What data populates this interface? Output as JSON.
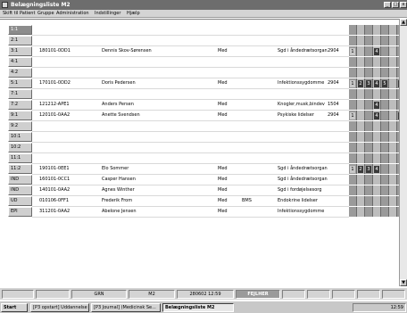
{
  "window": {
    "title": "Belægningsliste M2"
  },
  "menu": [
    "Skift til",
    "Patient",
    "Gruppe",
    "Administration",
    "Indstillinger",
    "Hjælp"
  ],
  "rows": [
    {
      "bed": "1:1",
      "cpr": "",
      "name": "",
      "sex": "",
      "x": "",
      "diag": "",
      "time": "",
      "marks": []
    },
    {
      "bed": "2:1",
      "cpr": "",
      "name": "",
      "sex": "",
      "x": "",
      "diag": "",
      "time": "",
      "marks": []
    },
    {
      "bed": "3:1",
      "cpr": "180101-0DD1",
      "name": "Dennis Skov-Sørensen",
      "sex": "Med",
      "x": "",
      "diag": "Sgd i åndedrætsorgan",
      "time": "2904",
      "marks": [
        {
          "c": 0,
          "t": "1",
          "light": true
        },
        {
          "c": 3,
          "t": "4"
        },
        {
          "c": 5,
          "t": "",
          "light": true
        }
      ]
    },
    {
      "bed": "4:1",
      "cpr": "",
      "name": "",
      "sex": "",
      "x": "",
      "diag": "",
      "time": "",
      "marks": []
    },
    {
      "bed": "4:2",
      "cpr": "",
      "name": "",
      "sex": "",
      "x": "",
      "diag": "",
      "time": "",
      "marks": []
    },
    {
      "bed": "5:1",
      "cpr": "170101-0DD2",
      "name": "Doris Pedersen",
      "sex": "Med",
      "x": "",
      "diag": "Infektionssygdomme",
      "time": "2904",
      "marks": [
        {
          "c": 0,
          "t": "1",
          "light": true
        },
        {
          "c": 1,
          "t": "2"
        },
        {
          "c": 2,
          "t": "3"
        },
        {
          "c": 3,
          "t": "4"
        },
        {
          "c": 4,
          "t": "5"
        },
        {
          "c": 6,
          "t": "7"
        }
      ]
    },
    {
      "bed": "7:1",
      "cpr": "",
      "name": "",
      "sex": "",
      "x": "",
      "diag": "",
      "time": "",
      "marks": []
    },
    {
      "bed": "7:2",
      "cpr": "121212-APE1",
      "name": "Anders Persen",
      "sex": "Med",
      "x": "",
      "diag": "Knogler,musk,bindev",
      "time": "1504",
      "marks": [
        {
          "c": 3,
          "t": "4"
        }
      ]
    },
    {
      "bed": "9:1",
      "cpr": "120101-0AA2",
      "name": "Anette Svendsen",
      "sex": "Med",
      "x": "",
      "diag": "Psykiske lidelser",
      "time": "2904",
      "marks": [
        {
          "c": 0,
          "t": "1",
          "light": true
        },
        {
          "c": 3,
          "t": "4"
        },
        {
          "c": 6,
          "t": "7"
        }
      ]
    },
    {
      "bed": "9:2",
      "cpr": "",
      "name": "",
      "sex": "",
      "x": "",
      "diag": "",
      "time": "",
      "marks": []
    },
    {
      "bed": "10:1",
      "cpr": "",
      "name": "",
      "sex": "",
      "x": "",
      "diag": "",
      "time": "",
      "marks": []
    },
    {
      "bed": "10:2",
      "cpr": "",
      "name": "",
      "sex": "",
      "x": "",
      "diag": "",
      "time": "",
      "marks": []
    },
    {
      "bed": "11:1",
      "cpr": "",
      "name": "",
      "sex": "",
      "x": "",
      "diag": "",
      "time": "",
      "marks": []
    },
    {
      "bed": "11:2",
      "cpr": "190101-0EE1",
      "name": "Elo Sommer",
      "sex": "Med",
      "x": "",
      "diag": "Sgd i åndedrætsorgan",
      "time": "",
      "marks": [
        {
          "c": 0,
          "t": "1",
          "light": true
        },
        {
          "c": 1,
          "t": "2"
        },
        {
          "c": 2,
          "t": "3"
        },
        {
          "c": 3,
          "t": "4"
        }
      ]
    },
    {
      "bed": "IND",
      "cpr": "160101-0CC1",
      "name": "Casper Hansen",
      "sex": "Med",
      "x": "",
      "diag": "Sgd i åndedrætsorgan",
      "time": "",
      "marks": []
    },
    {
      "bed": "IND",
      "cpr": "140101-0AA2",
      "name": "Agnes Winther",
      "sex": "Med",
      "x": "",
      "diag": "Sgd i fordøjelsesorg",
      "time": "",
      "marks": []
    },
    {
      "bed": "UD",
      "cpr": "010106-0FF1",
      "name": "Frederik From",
      "sex": "Med",
      "x": "BMS",
      "diag": "Endokrine lidelser",
      "time": "",
      "marks": []
    },
    {
      "bed": "EPI",
      "cpr": "311201-0AA2",
      "name": "Abelone Jensen",
      "sex": "Med",
      "x": "",
      "diag": "Infektionssygdomme",
      "time": "",
      "marks": []
    }
  ],
  "status": {
    "unit": "GRN",
    "ward": "M2",
    "datetime": "280602 12:59",
    "alert": "FEJLHER"
  },
  "taskbar": {
    "start": "Start",
    "tasks": [
      "[P3 opstart] Uddannelse",
      "[P3 Journal] (Medicinsk Se...",
      "Belægningsliste M2"
    ],
    "clock": "12:59"
  }
}
